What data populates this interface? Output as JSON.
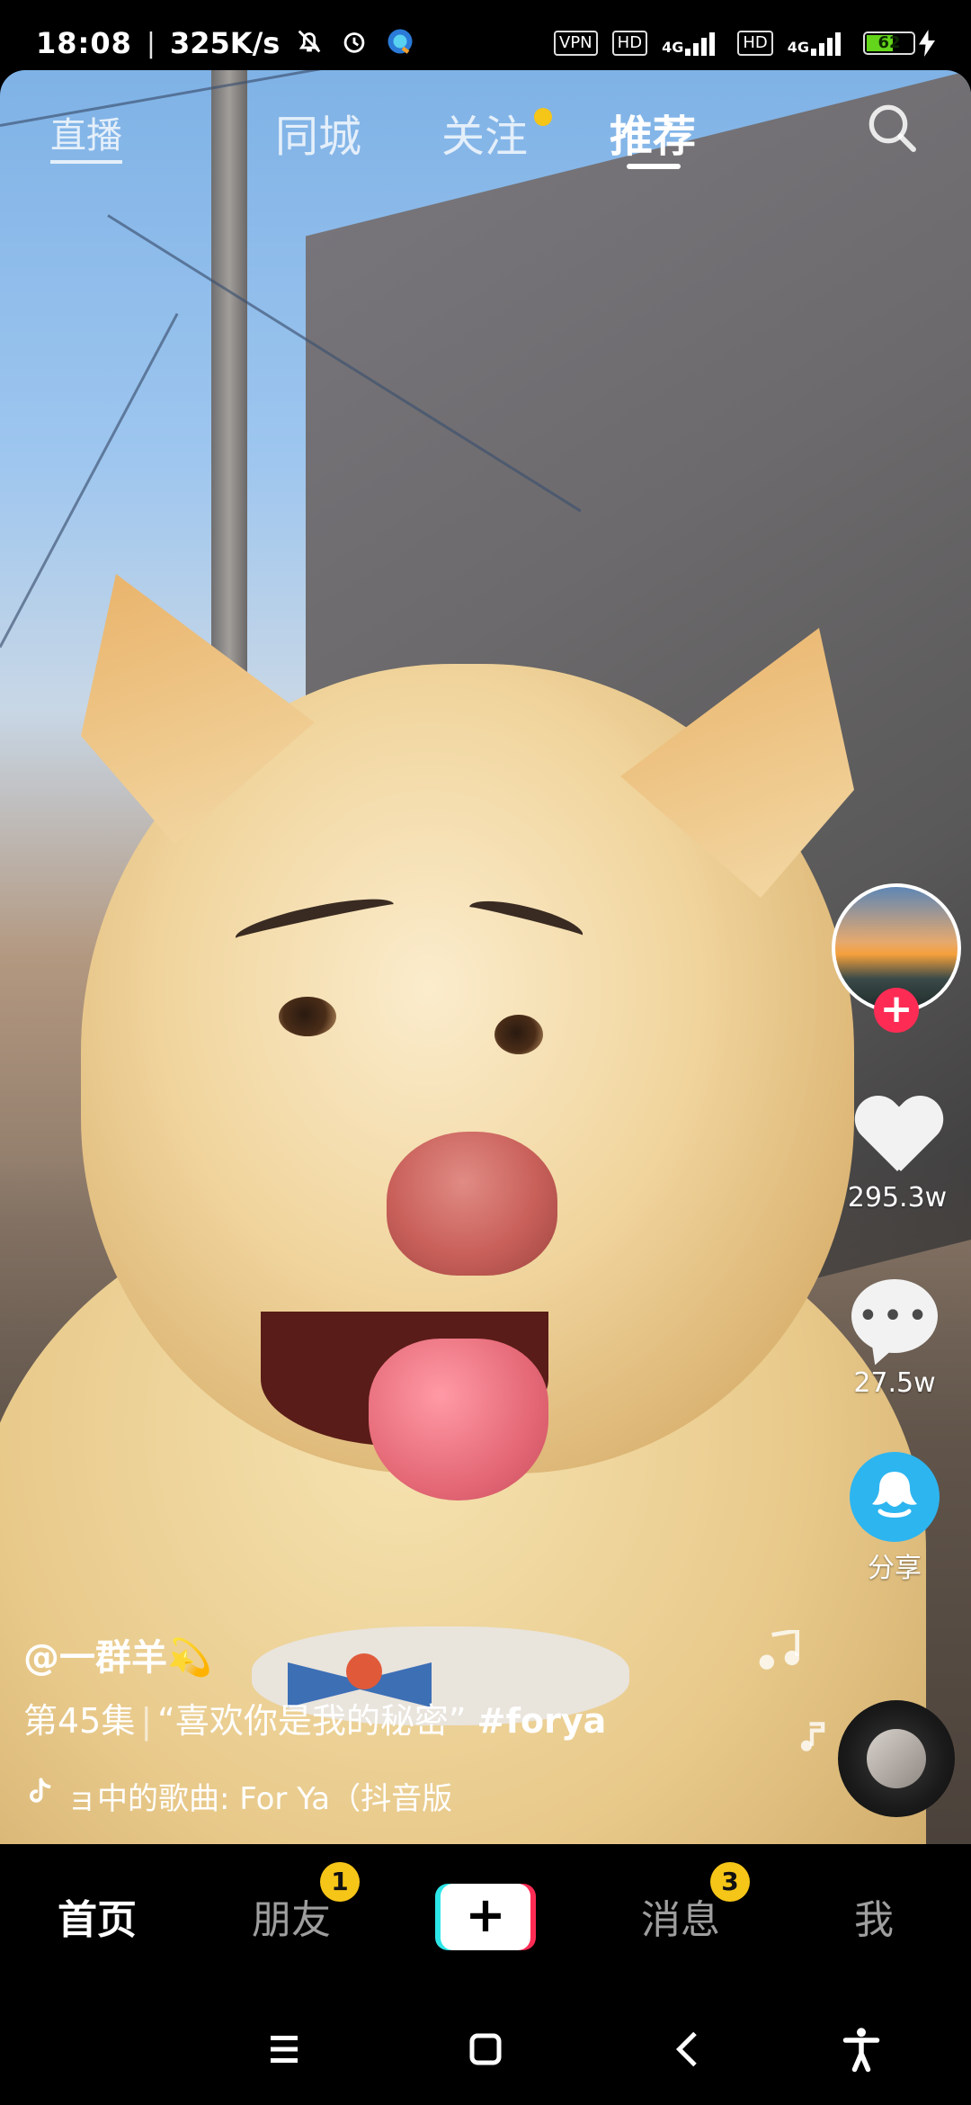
{
  "status_bar": {
    "time": "18:08",
    "separator": "|",
    "network_speed": "325K/s",
    "icons": [
      "bell-off-icon",
      "alarm-icon",
      "app-notification-icon"
    ],
    "vpn": "VPN",
    "hd1": "HD",
    "net1": "4G",
    "hd2": "HD",
    "net2": "4G",
    "battery": "62",
    "battery_level": 0.62,
    "charging_icon": "bolt-icon"
  },
  "top_nav": {
    "live": "直播",
    "tabs": [
      {
        "label": "同城"
      },
      {
        "label": "关注"
      },
      {
        "label": "推荐"
      }
    ],
    "active_tab": "推荐",
    "search_icon": "search-icon"
  },
  "actions": {
    "like_count": "295.3w",
    "comment_count": "27.5w",
    "share_label": "分享",
    "follow_icon": "plus-icon"
  },
  "video_info": {
    "author": "@一群羊💫",
    "episode": "第45集",
    "separator": "|",
    "title": "“喜欢你是我的秘密”",
    "hashtag": "#forya",
    "music_prefix": "ョ中的歌曲",
    "music": ": For Ya（抖音版"
  },
  "bottom_tabs": {
    "home": "首页",
    "friends": "朋友",
    "friends_badge": "1",
    "create": "+",
    "messages": "消息",
    "messages_badge": "3",
    "me": "我"
  },
  "system_nav": [
    "menu-icon",
    "home-icon",
    "back-icon",
    "accessibility-icon"
  ],
  "colors": {
    "accent_red": "#fe2c55",
    "accent_cyan": "#2de6e8",
    "badge_yellow": "#f5c518",
    "share_blue": "#2db5f0"
  }
}
